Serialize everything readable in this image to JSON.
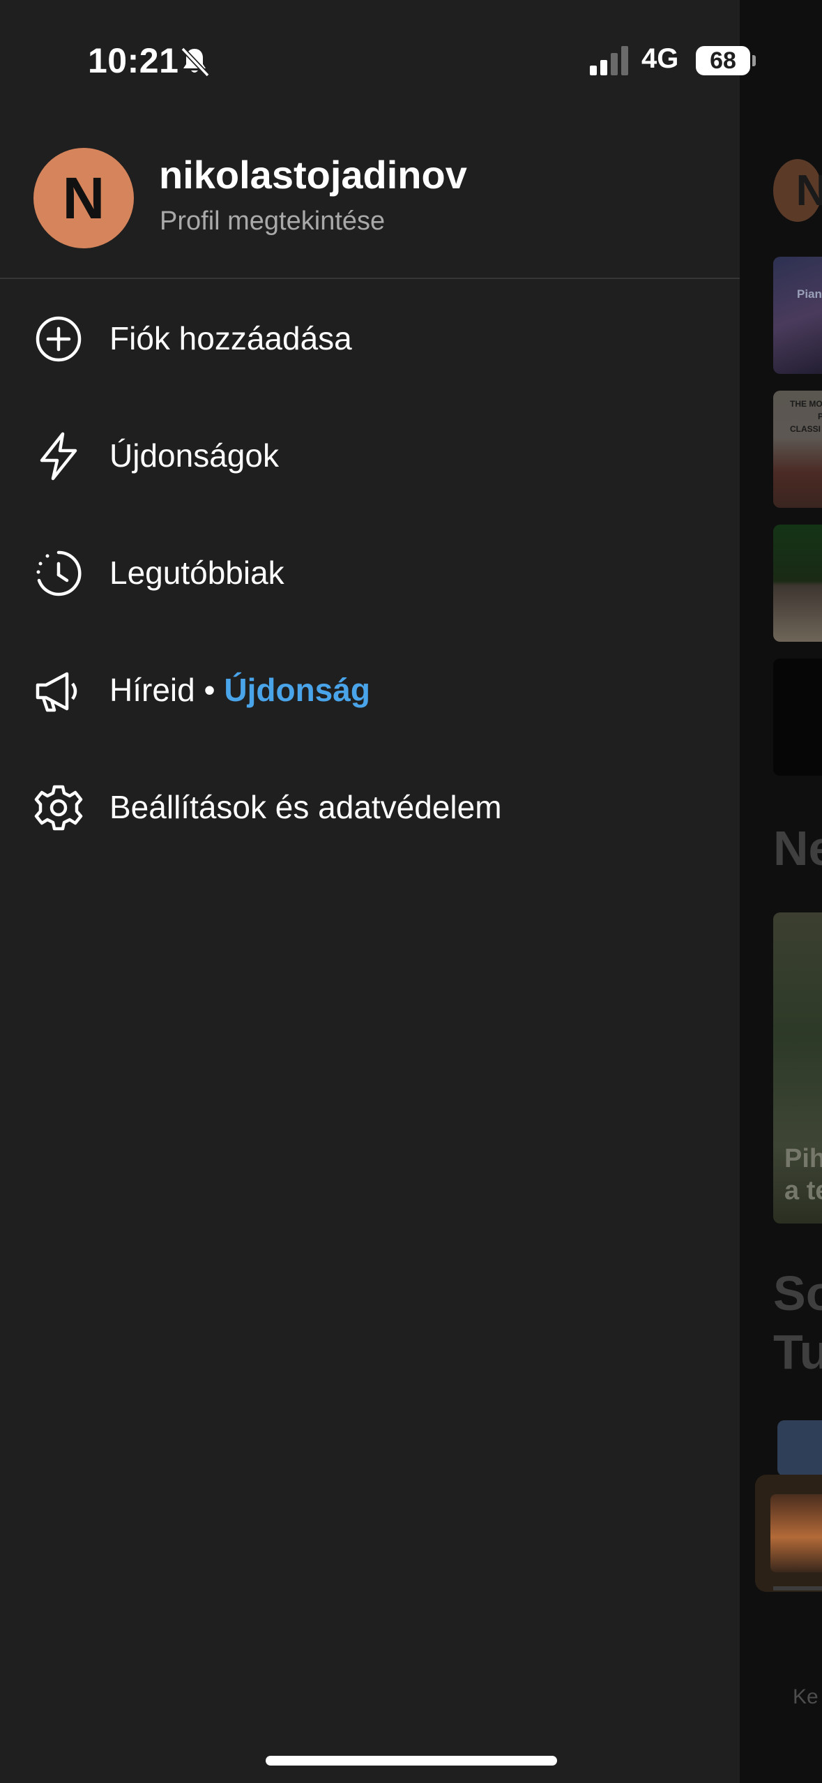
{
  "status_bar": {
    "time": "10:21",
    "network": "4G",
    "battery": "68"
  },
  "profile": {
    "initial": "N",
    "username": "nikolastojadinov",
    "link": "Profil megtekintése"
  },
  "menu": {
    "items": [
      {
        "label": "Fiók hozzáadása",
        "icon": "add-circle-icon"
      },
      {
        "label": "Újdonságok",
        "icon": "lightning-icon"
      },
      {
        "label": "Legutóbbiak",
        "icon": "recent-clock-icon"
      },
      {
        "label": "Híreid",
        "separator": " • ",
        "badge": "Újdonság",
        "icon": "megaphone-icon"
      },
      {
        "label": "Beállítások és adatvédelem",
        "icon": "settings-gear-icon"
      }
    ]
  },
  "background_app": {
    "avatar_initial": "N",
    "tile_text_1": "Pian",
    "tile_text_2a": "THE MO",
    "tile_text_2b": "P",
    "tile_text_2c": "CLASSI",
    "heading_1": "Ne",
    "tile_text_5a": "Pih",
    "tile_text_5b": "a te",
    "heading_2a": "So",
    "heading_2b": "Tu",
    "tab_label": "Ke"
  },
  "colors": {
    "drawer_bg": "#1f1f1f",
    "avatar": "#d6845c",
    "badge": "#4aa4ea",
    "secondary_text": "#a9a9a9"
  }
}
